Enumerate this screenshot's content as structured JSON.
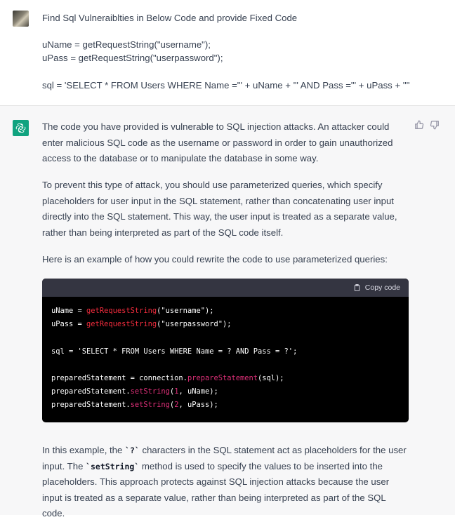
{
  "user_message": {
    "title": "Find Sql Vulneraiblties in Below Code and provide Fixed Code",
    "line1": "uName = getRequestString(\"username\");",
    "line2": "uPass = getRequestString(\"userpassword\");",
    "line3": "sql = 'SELECT * FROM Users WHERE Name =\"' + uName + '\" AND Pass =\"' + uPass + '\"'"
  },
  "assistant": {
    "para1": "The code you have provided is vulnerable to SQL injection attacks. An attacker could enter malicious SQL code as the username or password in order to gain unauthorized access to the database or to manipulate the database in some way.",
    "para2": "To prevent this type of attack, you should use parameterized queries, which specify placeholders for user input in the SQL statement, rather than concatenating user input directly into the SQL statement. This way, the user input is treated as a separate value, rather than being interpreted as part of the SQL code itself.",
    "para3": "Here is an example of how you could rewrite the code to use parameterized queries:",
    "copy_label": "Copy code",
    "code": {
      "l1_var": "uName = ",
      "l1_fn": "getRequestString",
      "l1_rest": "(\"username\");",
      "l2_var": "uPass = ",
      "l2_fn": "getRequestString",
      "l2_rest": "(\"userpassword\");",
      "l3": "sql = 'SELECT * FROM Users WHERE Name = ? AND Pass = ?';",
      "l4_a": "preparedStatement = connection.",
      "l4_fn": "prepareStatement",
      "l4_rest": "(sql);",
      "l5_a": "preparedStatement.",
      "l5_fn": "setString",
      "l5_p": "(",
      "l5_n": "1",
      "l5_rest": ", uName);",
      "l6_a": "preparedStatement.",
      "l6_fn": "setString",
      "l6_p": "(",
      "l6_n": "2",
      "l6_rest": ", uPass);"
    },
    "para4_a": "In this example, the ",
    "para4_code1": "`?`",
    "para4_b": " characters in the SQL statement act as placeholders for the user input. The ",
    "para4_code2": "`setString`",
    "para4_c": " method is used to specify the values to be inserted into the placeholders. This approach protects against SQL injection attacks because the user input is treated as a separate value, rather than being interpreted as part of the SQL code."
  },
  "colors": {
    "accent": "#10a37f",
    "code_bg": "#000000",
    "code_header": "#343541"
  }
}
